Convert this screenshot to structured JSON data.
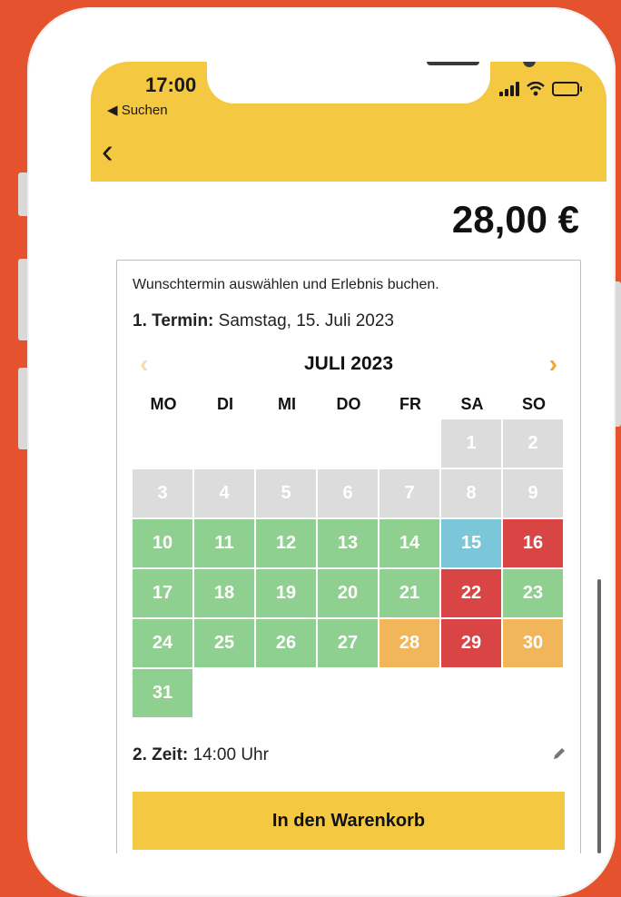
{
  "colors": {
    "background": "#e4532e",
    "appbar": "#f5c842",
    "available": "#8fcf8f",
    "disabled": "#dcdcdc",
    "selected": "#7cc6d9",
    "booked": "#d94545",
    "limited": "#f2b65a",
    "button": "#f5c842"
  },
  "status_bar": {
    "time": "17:00",
    "back_app": "◀ Suchen"
  },
  "header": {
    "back_icon": "chevron-left-icon",
    "back_glyph": "‹"
  },
  "price": "28,00 €",
  "booking": {
    "intro": "Wunschtermin auswählen und Erlebnis buchen.",
    "termin_label": "1. Termin:",
    "termin_value": "Samstag, 15. Juli 2023",
    "zeit_label": "2. Zeit:",
    "zeit_value": "14:00 Uhr",
    "cart_button": "In den Warenkorb"
  },
  "calendar": {
    "month": "JULI 2023",
    "prev_glyph": "‹",
    "next_glyph": "›",
    "weekdays": [
      "MO",
      "DI",
      "MI",
      "DO",
      "FR",
      "SA",
      "SO"
    ],
    "leading_blank": 5,
    "days": [
      {
        "d": "1",
        "s": "disabled"
      },
      {
        "d": "2",
        "s": "disabled"
      },
      {
        "d": "3",
        "s": "disabled"
      },
      {
        "d": "4",
        "s": "disabled"
      },
      {
        "d": "5",
        "s": "disabled"
      },
      {
        "d": "6",
        "s": "disabled"
      },
      {
        "d": "7",
        "s": "disabled"
      },
      {
        "d": "8",
        "s": "disabled"
      },
      {
        "d": "9",
        "s": "disabled"
      },
      {
        "d": "10",
        "s": "available"
      },
      {
        "d": "11",
        "s": "available"
      },
      {
        "d": "12",
        "s": "available"
      },
      {
        "d": "13",
        "s": "available"
      },
      {
        "d": "14",
        "s": "available"
      },
      {
        "d": "15",
        "s": "selected"
      },
      {
        "d": "16",
        "s": "booked"
      },
      {
        "d": "17",
        "s": "available"
      },
      {
        "d": "18",
        "s": "available"
      },
      {
        "d": "19",
        "s": "available"
      },
      {
        "d": "20",
        "s": "available"
      },
      {
        "d": "21",
        "s": "available"
      },
      {
        "d": "22",
        "s": "booked"
      },
      {
        "d": "23",
        "s": "available"
      },
      {
        "d": "24",
        "s": "available"
      },
      {
        "d": "25",
        "s": "available"
      },
      {
        "d": "26",
        "s": "available"
      },
      {
        "d": "27",
        "s": "available"
      },
      {
        "d": "28",
        "s": "limited"
      },
      {
        "d": "29",
        "s": "booked"
      },
      {
        "d": "30",
        "s": "limited"
      },
      {
        "d": "31",
        "s": "available"
      }
    ]
  }
}
